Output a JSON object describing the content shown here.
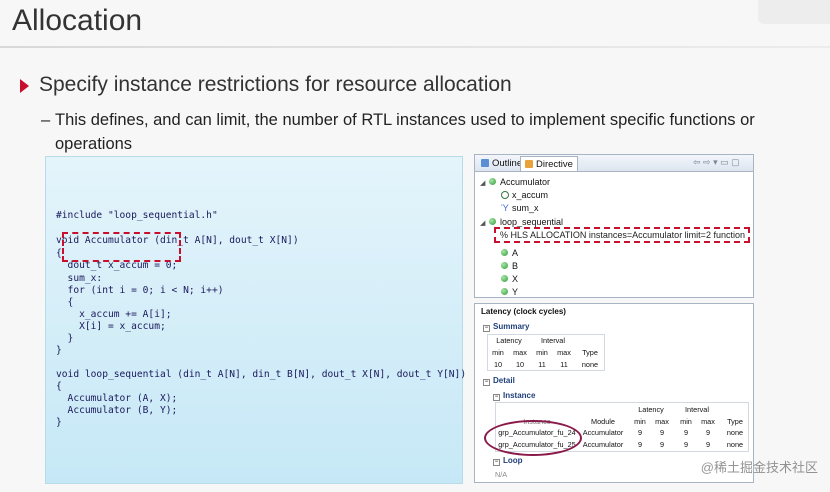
{
  "slide": {
    "title": "Allocation",
    "bullet": "Specify instance restrictions for resource allocation",
    "sub_dash": "–",
    "sub_bullet": "This defines, and can limit, the number of RTL instances used to implement specific functions or operations"
  },
  "code": {
    "lines": [
      "#include \"loop_sequential.h\"",
      "",
      "void Accumulator (din_t A[N], dout_t X[N])",
      "{",
      "  dout_t x_accum = 0;",
      "  sum_x:",
      "  for (int i = 0; i < N; i++)",
      "  {",
      "    x_accum += A[i];",
      "    X[i] = x_accum;",
      "  }",
      "}",
      "",
      "void loop_sequential (din_t A[N], din_t B[N], dout_t X[N], dout_t Y[N])",
      "{",
      "  Accumulator (A, X);",
      "  Accumulator (B, Y);",
      "}"
    ]
  },
  "directive_panel": {
    "tab_outline": "Outline",
    "tab_directive": "Directive",
    "toolbar_glyphs": "⇦ ⇨ ▾ ▭ ▢",
    "tree": {
      "accumulator": "Accumulator",
      "x_accum": "x_accum",
      "sum_x": "sum_x",
      "loop_sequential": "loop_sequential",
      "pragma_prefix": "%",
      "pragma": "HLS ALLOCATION instances=Accumulator limit=2 function",
      "ports": [
        "A",
        "B",
        "X",
        "Y"
      ]
    },
    "colors": {
      "directive_tab_icon": "#e8a33a",
      "outline_tab_icon": "#5a8fd6"
    }
  },
  "latency_panel": {
    "header": "Latency (clock cycles)",
    "summary_label": "Summary",
    "summary": {
      "group_headers": [
        "Latency",
        "Interval"
      ],
      "col_headers": [
        "min",
        "max",
        "min",
        "max",
        "Type"
      ],
      "row": [
        "10",
        "10",
        "11",
        "11",
        "none"
      ]
    },
    "detail_label": "Detail",
    "instance_label": "Instance",
    "instance_table": {
      "group_headers": [
        "Latency",
        "Interval"
      ],
      "col_headers": [
        "Instance",
        "Module",
        "min",
        "max",
        "min",
        "max",
        "Type"
      ],
      "rows": [
        [
          "grp_Accumulator_fu_24",
          "Accumulator",
          "9",
          "9",
          "9",
          "9",
          "none"
        ],
        [
          "grp_Accumulator_fu_25",
          "Accumulator",
          "9",
          "9",
          "9",
          "9",
          "none"
        ]
      ]
    },
    "loop_label": "Loop",
    "loop_value": "N/A"
  },
  "watermark": "@稀土掘金技术社区",
  "colors": {
    "accent_red": "#c8102e",
    "ellipse": "#8b1a4a",
    "code_text": "#1a1a5c"
  }
}
